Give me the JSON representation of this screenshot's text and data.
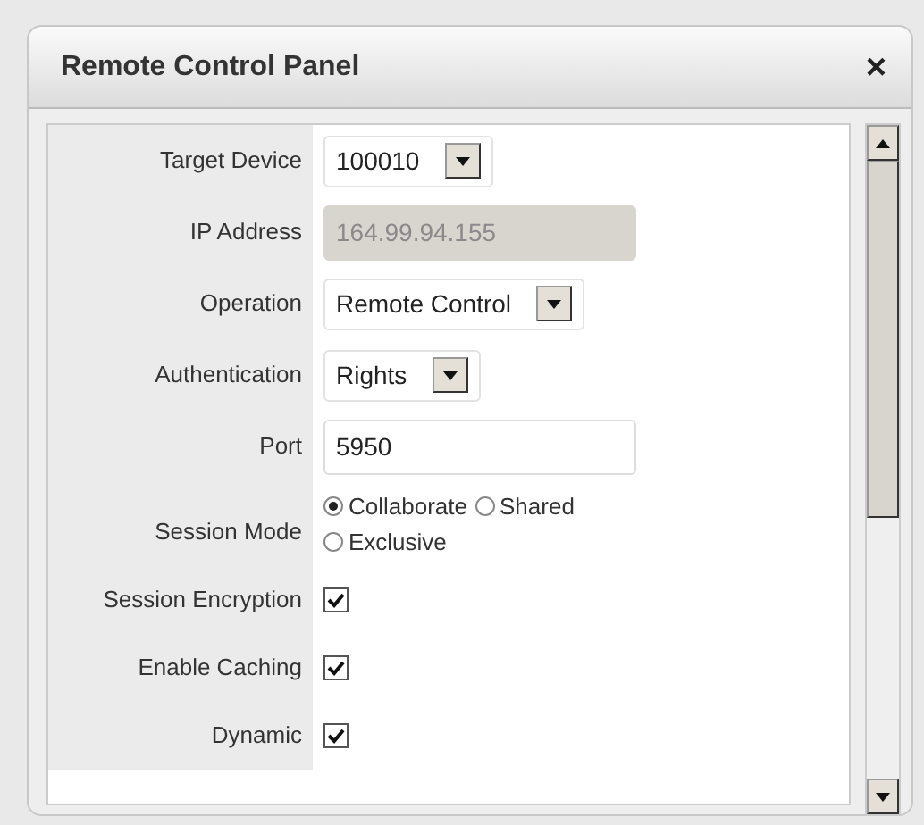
{
  "window": {
    "title": "Remote Control Panel",
    "close": "×"
  },
  "fields": [
    {
      "label": "Target Device",
      "kind": "select",
      "value": "100010",
      "disabled": false
    },
    {
      "label": "IP Address",
      "kind": "text",
      "value": "164.99.94.155",
      "disabled": true
    },
    {
      "label": "Operation",
      "kind": "select",
      "value": "Remote Control",
      "disabled": false
    },
    {
      "label": "Authentication",
      "kind": "select",
      "value": "Rights",
      "disabled": false
    },
    {
      "label": "Port",
      "kind": "text",
      "value": "5950",
      "disabled": false
    },
    {
      "label": "Session Mode",
      "kind": "radio",
      "options": [
        {
          "label": "Collaborate",
          "selected": true
        },
        {
          "label": "Shared",
          "selected": false
        },
        {
          "label": "Exclusive",
          "selected": false
        }
      ]
    },
    {
      "label": "Session Encryption",
      "kind": "checkbox",
      "checked": true
    },
    {
      "label": "Enable Caching",
      "kind": "checkbox",
      "checked": true
    },
    {
      "label": "Dynamic",
      "kind": "checkbox",
      "checked": true
    }
  ]
}
